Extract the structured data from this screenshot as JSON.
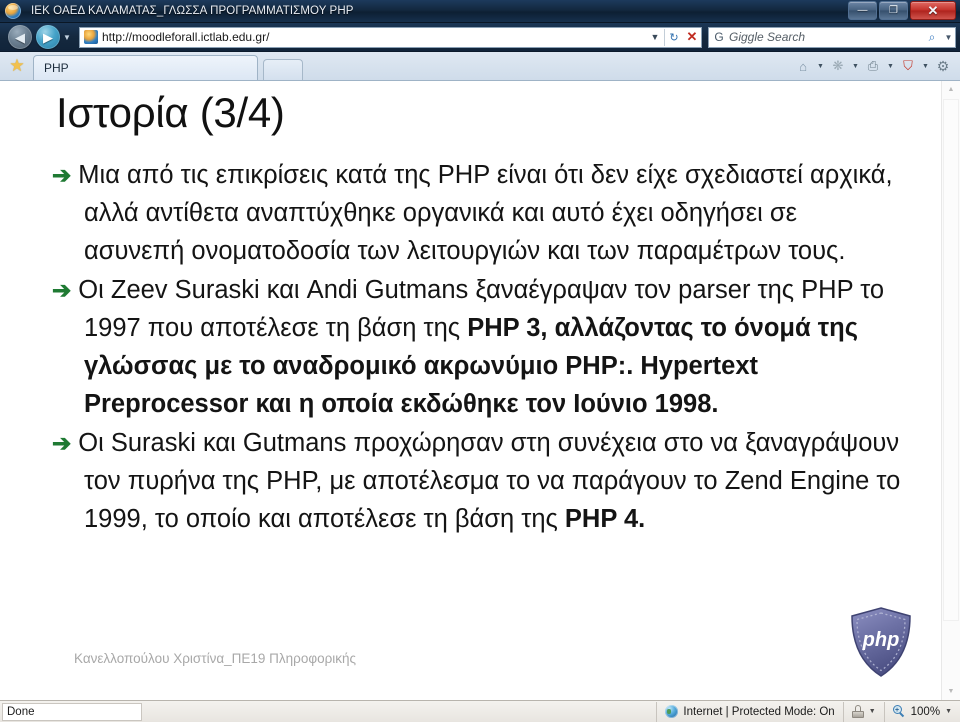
{
  "window": {
    "title": "ΙΕΚ ΟΑΕΔ ΚΑΛΑΜΑΤΑΣ_ΓΛΩΣΣΑ ΠΡΟΓΡΑΜΜΑΤΙΣΜΟΥ PHP",
    "app_icon": "globe-icon",
    "minimize_label": "—",
    "maximize_label": "❐",
    "close_label": "✕"
  },
  "navigation": {
    "back_label": "◀",
    "forward_label": "▶",
    "history_caret": "▼",
    "address": {
      "url": "http://moodleforall.ictlab.edu.gr/",
      "favicon": "site-favicon",
      "dropdown_caret": "▼",
      "refresh_label": "↻",
      "stop_label": "✕"
    },
    "search": {
      "provider_icon": "G",
      "placeholder": "Giggle Search",
      "go_label": "⌕",
      "dropdown_caret": "▼"
    }
  },
  "tabs": {
    "favorites_icon": "star-icon",
    "items": [
      {
        "label": "PHP",
        "active": true
      }
    ],
    "new_tab_label": ""
  },
  "toolbar": {
    "items": [
      {
        "name": "home-icon",
        "glyph": "⌂",
        "caret": "▼"
      },
      {
        "name": "feed-icon",
        "glyph": "❋",
        "caret": "▼"
      },
      {
        "name": "print-icon",
        "glyph": "⎙",
        "caret": "▼"
      },
      {
        "name": "safety-icon",
        "glyph": "⛉",
        "caret": "▼"
      },
      {
        "name": "tools-icon",
        "glyph": "⚙",
        "caret": ""
      }
    ]
  },
  "slide": {
    "title": "Ιστορία (3/4)",
    "bullet_marker": "➔",
    "bullets": [
      {
        "id": "bullet-1",
        "segments": [
          {
            "text": "Μια από τις επικρίσεις κατά της PHP είναι ότι δεν είχε σχεδιαστεί αρχικά, αλλά αντίθετα αναπτύχθηκε οργανικά και αυτό έχει οδηγήσει σε ασυνεπή ονοματοδοσία των λειτουργιών και των παραμέτρων τους.",
            "bold": false
          }
        ]
      },
      {
        "id": "bullet-2",
        "segments": [
          {
            "text": "Οι Zeev Suraski και Andi Gutmans ξαναέγραψαν τον parser της PHP το 1997 που αποτέλεσε τη βάση της ",
            "bold": false
          },
          {
            "text": "PHP 3, αλλάζοντας το όνομά της γλώσσας με το αναδρομικό ακρωνύμιο PHP:. Hypertext Preprocessor και η οποία εκδώθηκε τον Ιούνιο 1998.",
            "bold": true
          }
        ]
      },
      {
        "id": "bullet-3",
        "segments": [
          {
            "text": "Οι Suraski και Gutmans προχώρησαν στη συνέχεια στο να ξαναγράψουν τον πυρήνα της PHP, με αποτέλεσμα το να παράγουν το Zend Engine το 1999, το οποίο και αποτέλεσε τη βάση της ",
            "bold": false
          },
          {
            "text": "PHP 4.",
            "bold": true
          }
        ]
      }
    ],
    "credit": "Κανελλοπούλου Χριστίνα_ΠΕ19 Πληροφορικής",
    "logo": {
      "name": "php-shield-logo",
      "text": "php",
      "color": "#6b6fa8"
    }
  },
  "scrollbar": {
    "up_label": "▲",
    "down_label": "▼"
  },
  "statusbar": {
    "status_text": "Done",
    "zone_text": "Internet | Protected Mode: On",
    "zone_icon": "globe-icon",
    "protection_icon": "padlock-icon",
    "protection_caret": "▼",
    "zoom_level": "100%",
    "zoom_icon": "magnifier-icon",
    "zoom_caret": "▼"
  }
}
